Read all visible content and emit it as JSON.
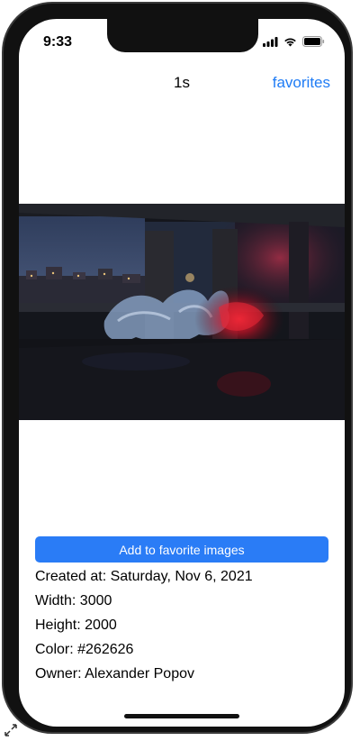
{
  "status_bar": {
    "time": "9:33"
  },
  "nav": {
    "title": "1s",
    "favorites_label": "favorites"
  },
  "photo": {
    "icon": "photo-image"
  },
  "actions": {
    "add_favorite_label": "Add to favorite images"
  },
  "details": {
    "created": "Created at: Saturday, Nov 6, 2021",
    "width": "Width: 3000",
    "height": "Height: 2000",
    "color": "Color: #262626",
    "owner": "Owner: Alexander Popov"
  },
  "colors": {
    "accent": "#1f7cf5",
    "button": "#2a7cf6"
  }
}
